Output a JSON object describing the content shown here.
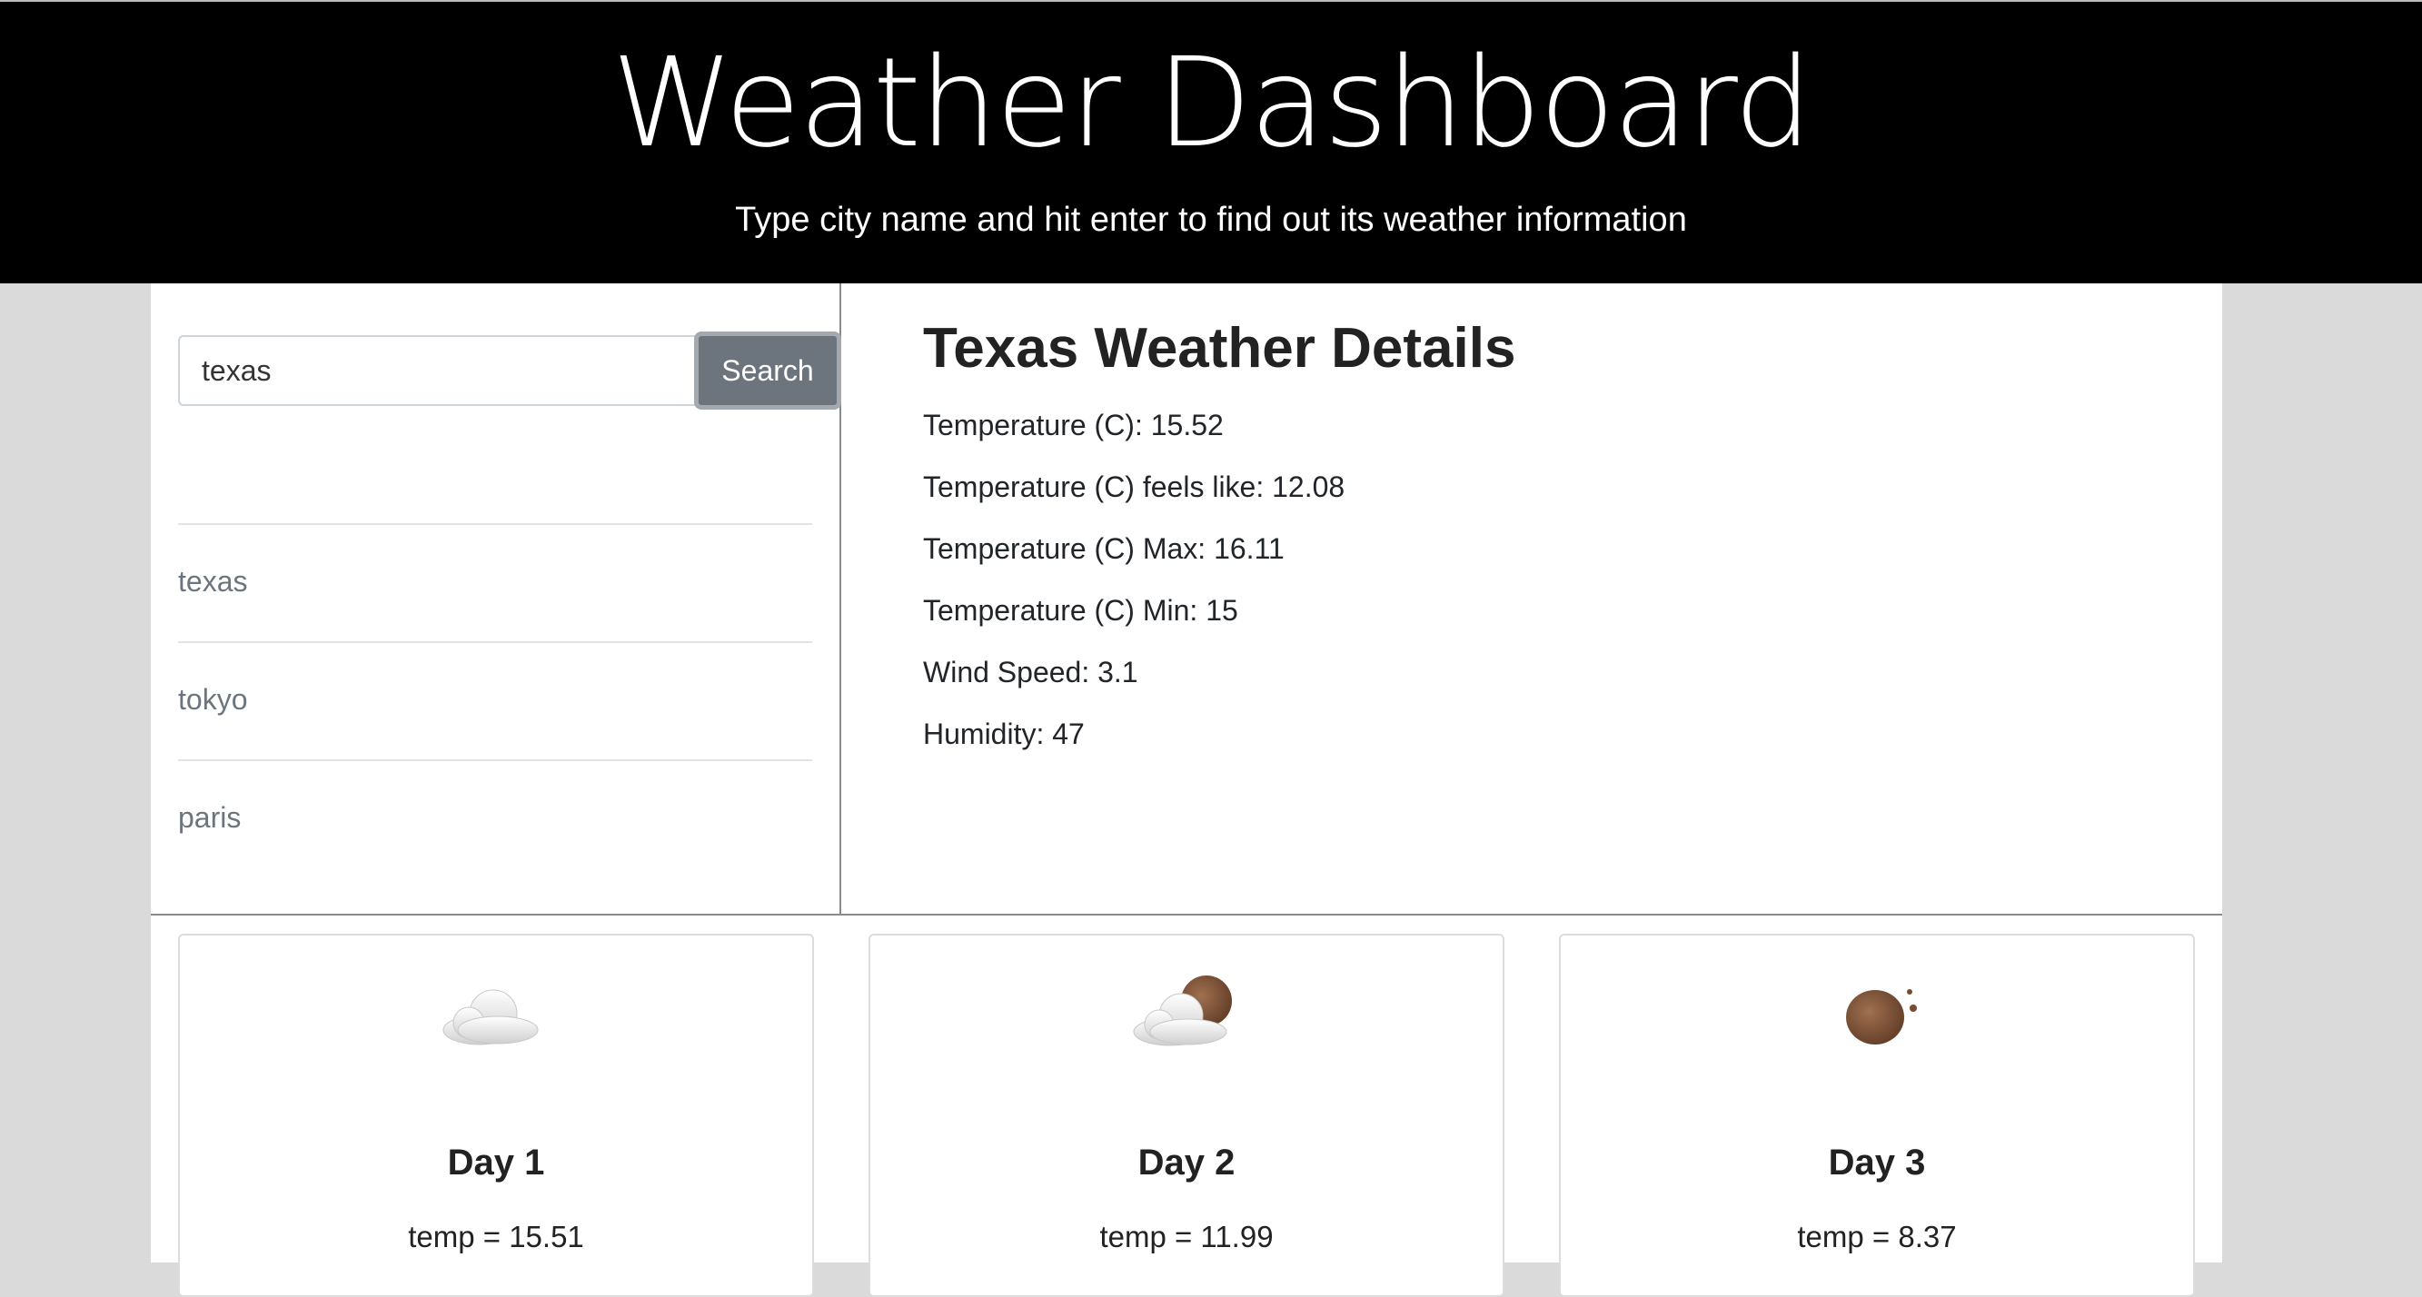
{
  "header": {
    "title": "Weather Dashboard",
    "subtitle": "Type city name and hit enter to find out its weather information"
  },
  "search": {
    "value": "texas",
    "button_label": "Search"
  },
  "history": [
    "texas",
    "tokyo",
    "paris"
  ],
  "details": {
    "heading": "Texas Weather Details",
    "lines": [
      "Temperature (C): 15.52",
      "Temperature (C) feels like: 12.08",
      "Temperature (C) Max: 16.11",
      "Temperature (C) Min: 15",
      "Wind Speed: 3.1",
      "Humidity: 47"
    ]
  },
  "forecast": [
    {
      "day": "Day 1",
      "temp": "temp = 15.51",
      "icon": "cloud-icon"
    },
    {
      "day": "Day 2",
      "temp": "temp = 11.99",
      "icon": "partly-cloudy-night-icon"
    },
    {
      "day": "Day 3",
      "temp": "temp = 8.37",
      "icon": "clear-night-icon"
    }
  ],
  "colors": {
    "header_bg": "#000000",
    "page_bg": "#dadada",
    "button_bg": "#6c757d",
    "moon": "#8a5a3c"
  }
}
